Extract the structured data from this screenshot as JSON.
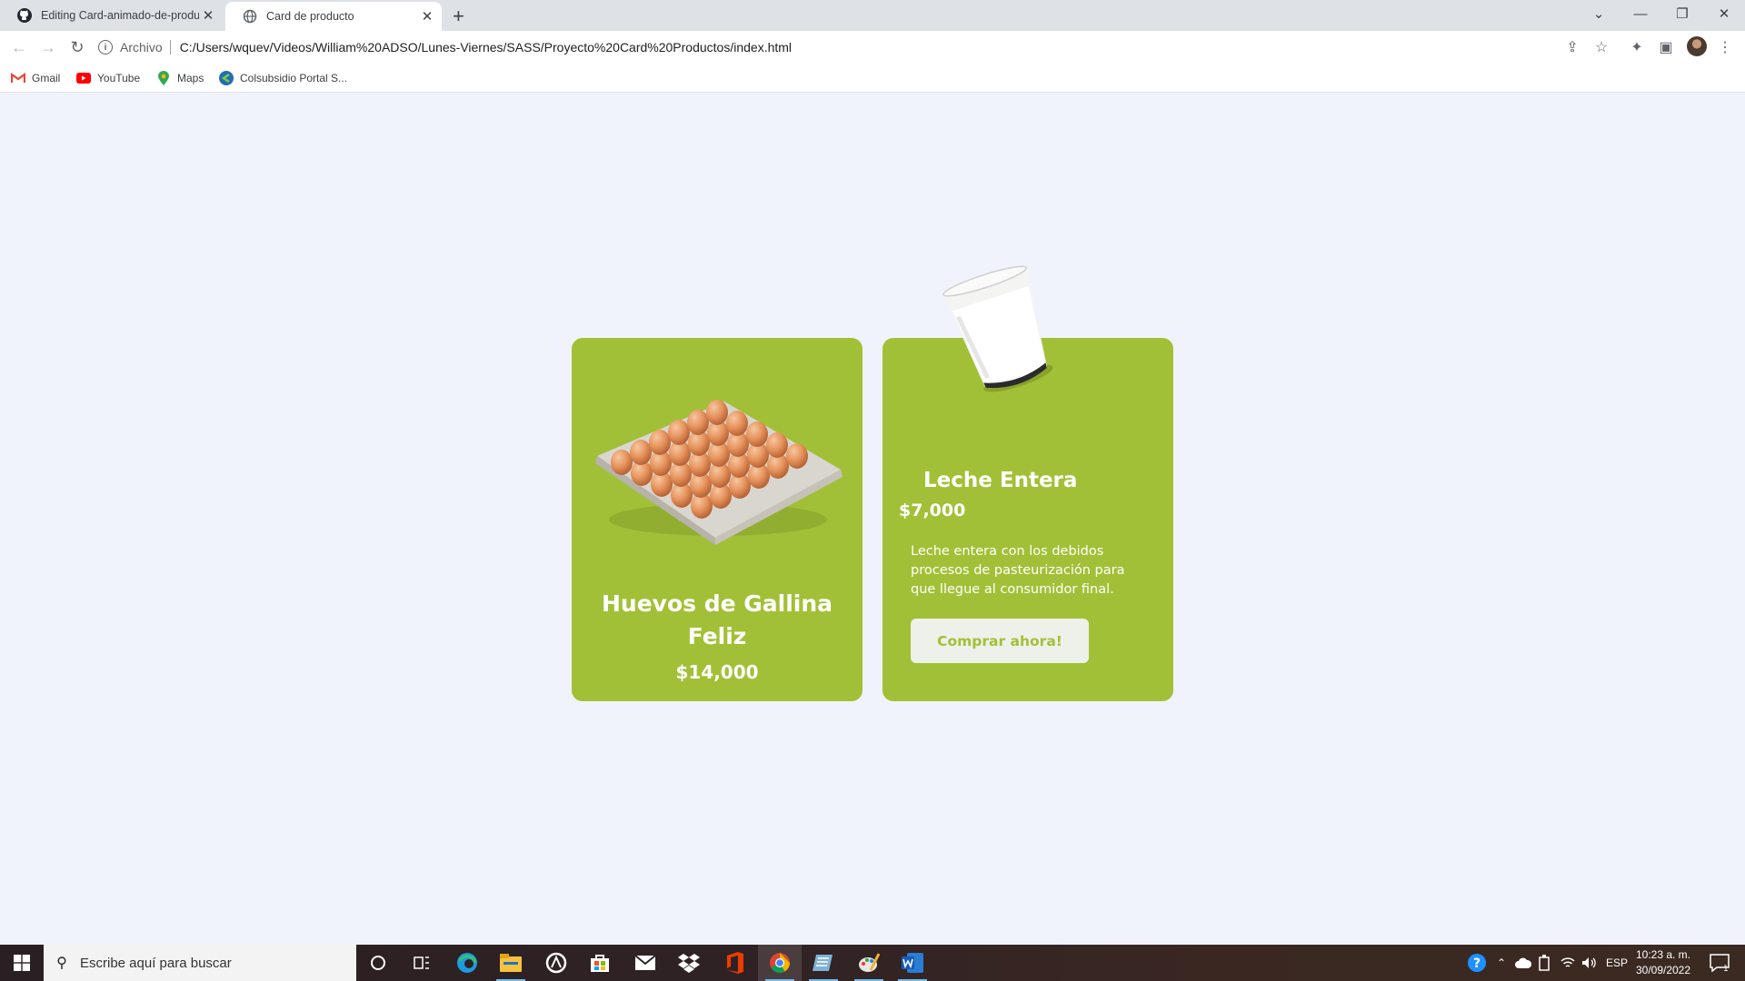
{
  "browser": {
    "tabs": [
      {
        "title": "Editing Card-animado-de-produc",
        "favicon": "github-icon",
        "active": false
      },
      {
        "title": "Card de producto",
        "favicon": "globe-icon",
        "active": true
      }
    ],
    "address_scheme_label": "Archivo",
    "url": "C:/Users/wquev/Videos/William%20ADSO/Lunes-Viernes/SASS/Proyecto%20Card%20Productos/index.html",
    "bookmarks": [
      {
        "label": "Gmail",
        "icon": "gmail-icon"
      },
      {
        "label": "YouTube",
        "icon": "youtube-icon"
      },
      {
        "label": "Maps",
        "icon": "maps-icon"
      },
      {
        "label": "Colsubsidio Portal S...",
        "icon": "colsubsidio-icon"
      }
    ]
  },
  "products": [
    {
      "title": "Huevos de Gallina Feliz",
      "price": "$14,000",
      "image": "egg-tray"
    },
    {
      "title": "Leche Entera",
      "price": "$7,000",
      "image": "milk-glass",
      "description": "Leche entera con los debidos procesos de pasteurización para que llegue al consumidor final.",
      "button_label": "Comprar ahora!"
    }
  ],
  "colors": {
    "card_green": "#a2c037",
    "page_bg": "#f0f3fc",
    "button_bg": "#eef0ea"
  },
  "taskbar": {
    "search_placeholder": "Escribe aquí para buscar",
    "language": "ESP",
    "time": "10:23 a. m.",
    "date": "30/09/2022",
    "notification_count": "1"
  }
}
